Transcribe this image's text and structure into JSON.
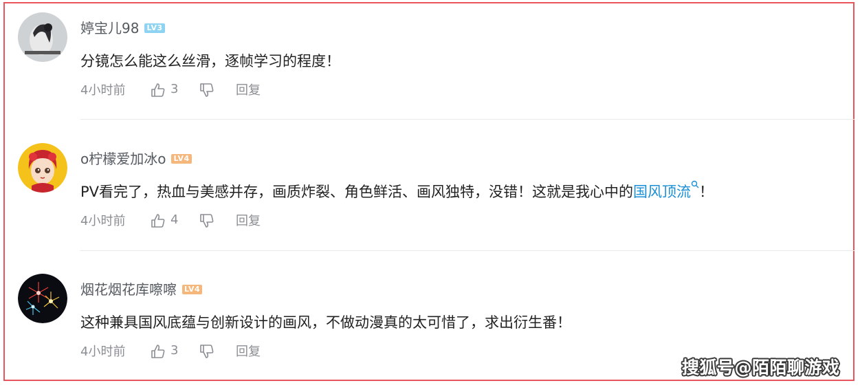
{
  "comments": [
    {
      "username": "婷宝儿98",
      "level": "LV3",
      "text": "分镜怎么能这么丝滑，逐帧学习的程度！",
      "time": "4小时前",
      "likes": "3",
      "reply_label": "回复",
      "avatar_icon": "avatar-girl-photo"
    },
    {
      "username": "o柠檬爱加冰o",
      "level": "LV4",
      "text_before": "PV看完了，热血与美感并存，画质炸裂、角色鲜活、画风独特，没错！这就是我心中的",
      "hashtag": "国风顶流",
      "text_after": "！",
      "time": "4小时前",
      "likes": "4",
      "reply_label": "回复",
      "avatar_icon": "avatar-cartoon-girl"
    },
    {
      "username": "烟花烟花库嚓嚓",
      "level": "LV4",
      "text": "这种兼具国风底蕴与创新设计的画风，不做动漫真的太可惜了，求出衍生番！",
      "time": "4小时前",
      "likes": "3",
      "reply_label": "回复",
      "avatar_icon": "avatar-fireworks"
    }
  ],
  "watermark": "搜狐号@陌陌聊游戏",
  "colors": {
    "border": "#e8545c",
    "hashtag": "#1a8fd6",
    "level3": "#8ed4f2",
    "level4": "#f6b77c"
  }
}
